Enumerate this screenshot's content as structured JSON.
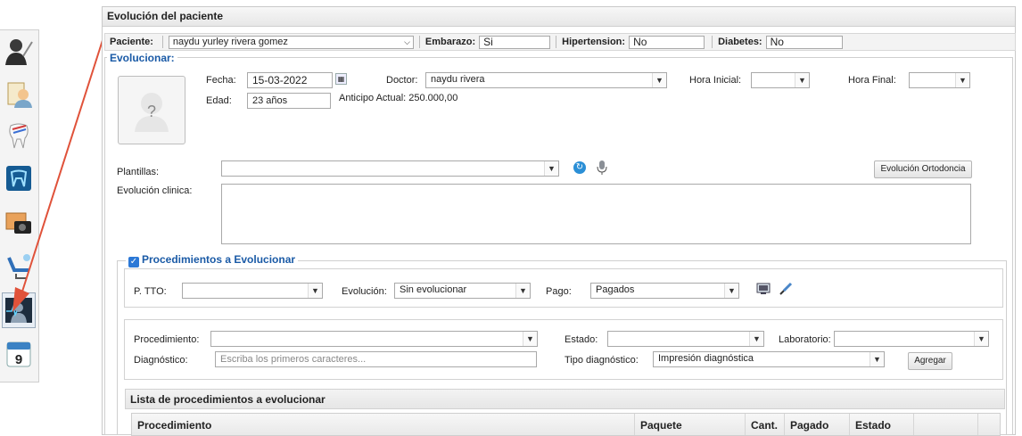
{
  "panel": {
    "title": "Evolución del paciente"
  },
  "patient_bar": {
    "patient_label": "Paciente:",
    "patient_value": "naydu yurley rivera gomez",
    "embarazo_label": "Embarazo:",
    "embarazo_value": "Si",
    "hipertension_label": "Hipertension:",
    "hipertension_value": "No",
    "diabetes_label": "Diabetes:",
    "diabetes_value": "No"
  },
  "evolucionar": {
    "legend": "Evolucionar:",
    "fecha_label": "Fecha:",
    "fecha_value": "15-03-2022",
    "doctor_label": "Doctor:",
    "doctor_value": "naydu rivera",
    "hora_inicial_label": "Hora Inicial:",
    "hora_inicial_value": "",
    "hora_final_label": "Hora Final:",
    "hora_final_value": "",
    "edad_label": "Edad:",
    "edad_value": "23 años",
    "anticipo": "Anticipo Actual: 250.000,00",
    "plantillas_label": "Plantillas:",
    "plantillas_value": "",
    "evolucion_ortodoncia_button": "Evolución Ortodoncia",
    "evolucion_clinica_label": "Evolución clinica:"
  },
  "procedimientos": {
    "legend": "Procedimientos a Evolucionar",
    "checked": true,
    "ptto_label": "P. TTO:",
    "ptto_value": "",
    "evolucion_label": "Evolución:",
    "evolucion_value": "Sin evolucionar",
    "pago_label": "Pago:",
    "pago_value": "Pagados",
    "procedimiento_label": "Procedimiento:",
    "procedimiento_value": "",
    "estado_label": "Estado:",
    "estado_value": "",
    "laboratorio_label": "Laboratorio:",
    "laboratorio_value": "",
    "diagnostico_label": "Diagnóstico:",
    "diagnostico_placeholder": "Escriba los primeros caracteres...",
    "tipo_diagnostico_label": "Tipo diagnóstico:",
    "tipo_diagnostico_value": "Impresión diagnóstica",
    "agregar_button": "Agregar"
  },
  "lista": {
    "title": "Lista de procedimientos a evolucionar",
    "columns": [
      "Procedimiento",
      "Paquete",
      "Cant.",
      "Pagado",
      "Estado"
    ]
  },
  "toolbar": {
    "items": [
      {
        "icon": "doctor-icon"
      },
      {
        "icon": "patient-file-icon"
      },
      {
        "icon": "tooth-icon"
      },
      {
        "icon": "odontogram-icon"
      },
      {
        "icon": "photo-camera-icon"
      },
      {
        "icon": "dental-chair-icon"
      },
      {
        "icon": "evolution-monitor-icon"
      },
      {
        "icon": "calendar-icon"
      }
    ],
    "calendar_day": "9"
  },
  "colors": {
    "accent": "#1a5aa6",
    "annotation_arrow": "#e0523a"
  }
}
